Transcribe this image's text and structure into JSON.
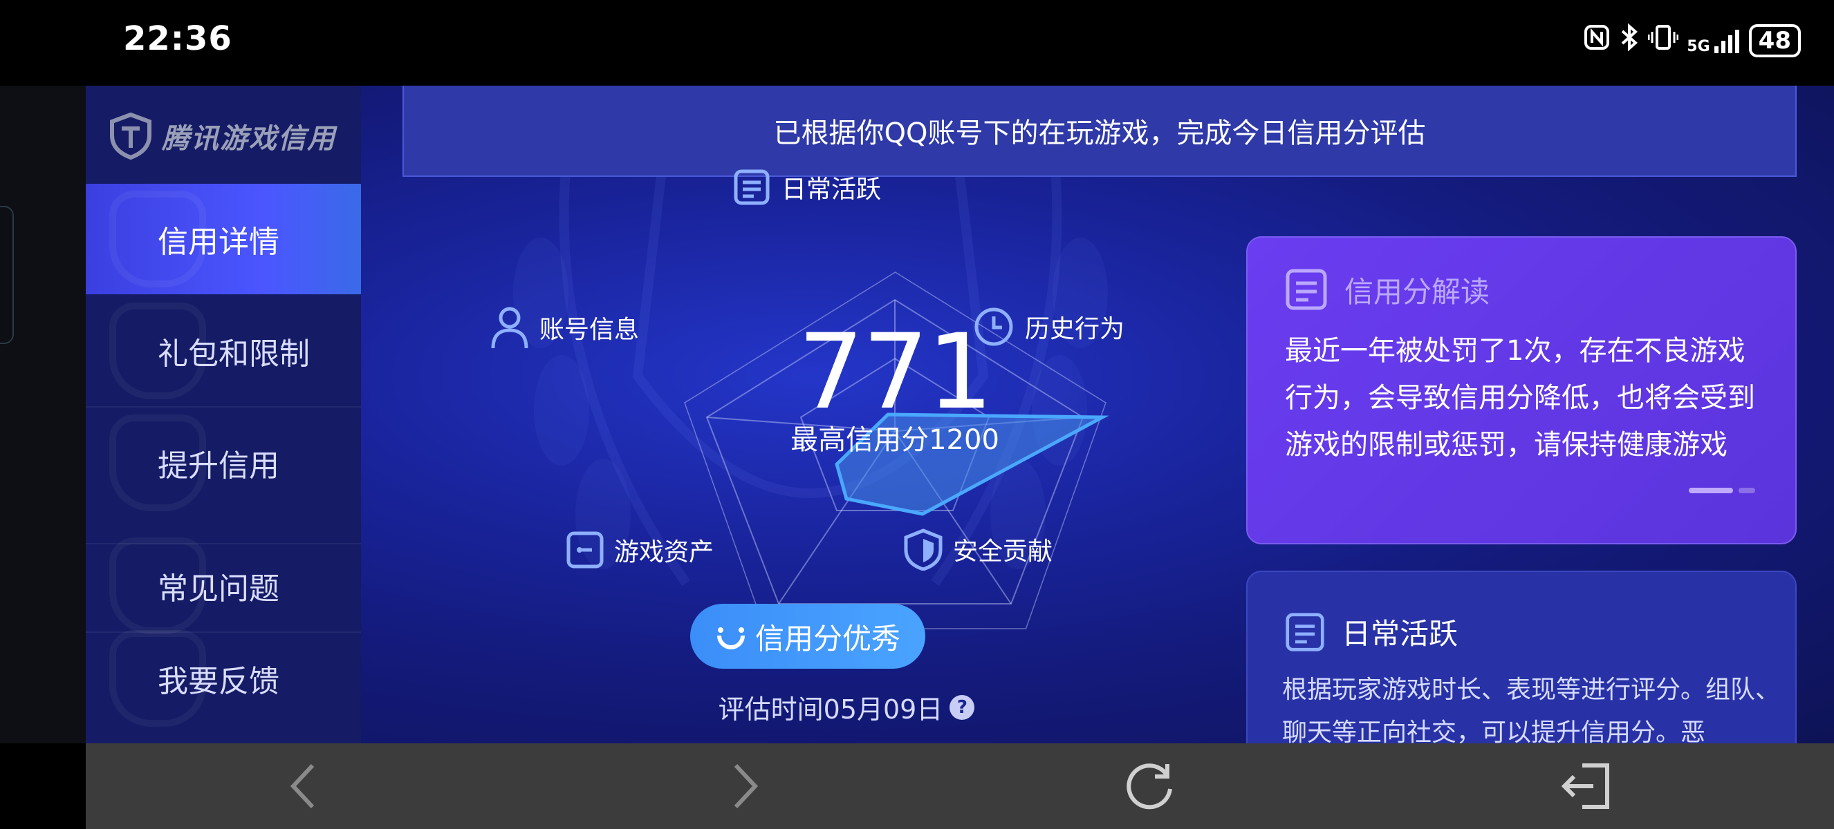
{
  "status_bar": {
    "time": "22:36",
    "network_label": "5G",
    "battery": "48",
    "icons": [
      "nfc-icon",
      "bluetooth-icon",
      "vibrate-icon",
      "signal-icon",
      "battery-icon"
    ]
  },
  "sidebar": {
    "logo_text": "腾讯游戏信用",
    "items": [
      {
        "label": "信用详情",
        "active": true
      },
      {
        "label": "礼包和限制",
        "active": false
      },
      {
        "label": "提升信用",
        "active": false
      },
      {
        "label": "常见问题",
        "active": false
      },
      {
        "label": "我要反馈",
        "active": false
      }
    ]
  },
  "banner": {
    "text": "已根据你QQ账号下的在玩游戏，完成今日信用分评估"
  },
  "radar": {
    "score": "771",
    "max_label": "最高信用分1200",
    "axes": [
      {
        "label": "日常活跃",
        "icon": "document-icon"
      },
      {
        "label": "历史行为",
        "icon": "clock-icon"
      },
      {
        "label": "安全贡献",
        "icon": "shield-icon"
      },
      {
        "label": "游戏资产",
        "icon": "key-icon"
      },
      {
        "label": "账号信息",
        "icon": "person-icon"
      }
    ],
    "badge": "信用分优秀",
    "eval_time": "评估时间05月09日",
    "help": "?"
  },
  "card_interpret": {
    "title": "信用分解读",
    "body": "最近一年被处罚了1次，存在不良游戏行为，会导致信用分降低，也将会受到游戏的限制或惩罚，请保持健康游戏"
  },
  "card_daily": {
    "title": "日常活跃",
    "body": "根据玩家游戏时长、表现等进行评分。组队、聊天等正向社交，可以提升信用分。恶"
  },
  "bottom_bar": {
    "buttons": [
      "back-icon",
      "forward-icon",
      "refresh-icon",
      "exit-icon"
    ]
  },
  "colors": {
    "accent": "#4aa3ff",
    "sidebar_active": "#4b56ff",
    "card_purple": "#6a3df0"
  }
}
